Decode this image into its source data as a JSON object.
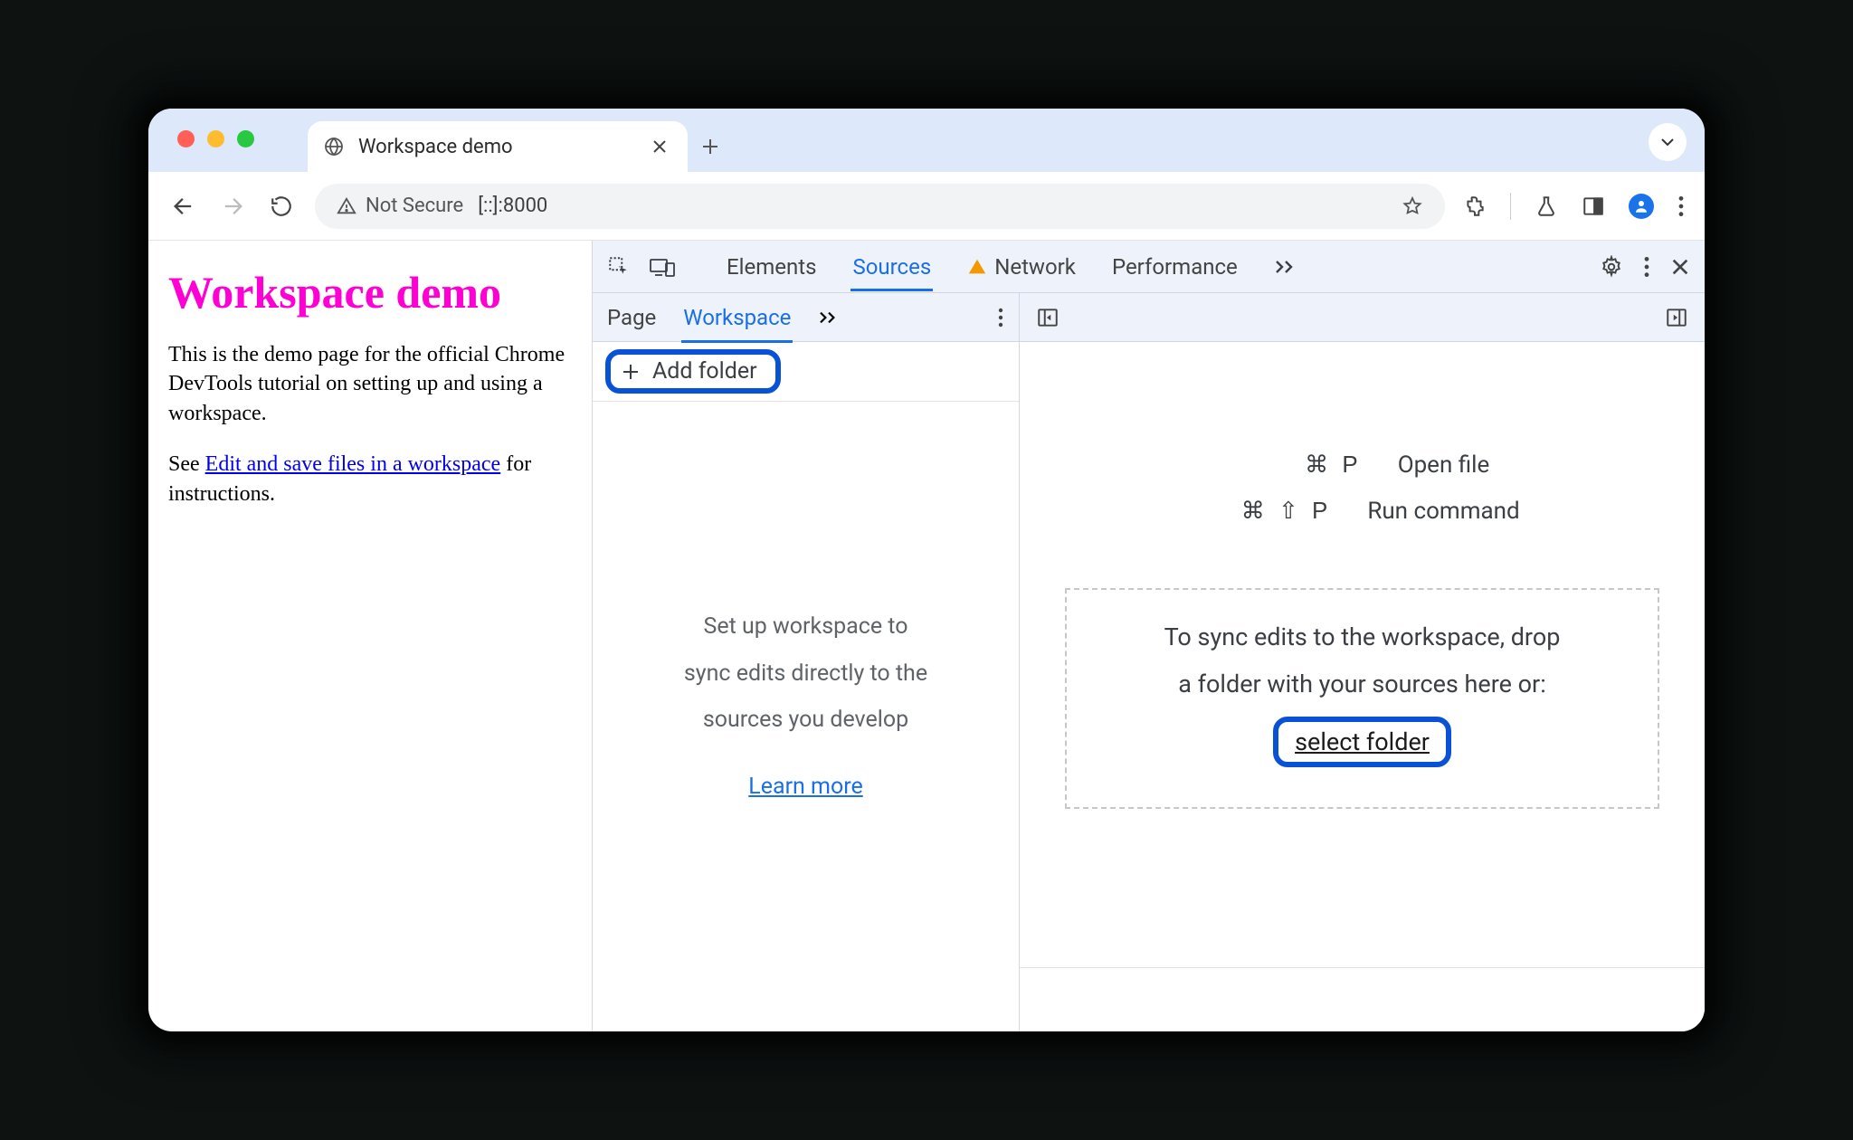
{
  "browser": {
    "tab_title": "Workspace demo",
    "not_secure_label": "Not Secure",
    "url": "[::]:8000"
  },
  "page": {
    "heading": "Workspace demo",
    "p1": "This is the demo page for the official Chrome DevTools tutorial on setting up and using a workspace.",
    "p2_prefix": "See ",
    "p2_link": "Edit and save files in a workspace",
    "p2_suffix": " for instructions."
  },
  "devtools": {
    "tabs": {
      "elements": "Elements",
      "sources": "Sources",
      "network": "Network",
      "performance": "Performance"
    },
    "sub_tabs": {
      "page": "Page",
      "workspace": "Workspace"
    },
    "add_folder": "Add folder",
    "workspace_hint_l1": "Set up workspace to",
    "workspace_hint_l2": "sync edits directly to the",
    "workspace_hint_l3": "sources you develop",
    "learn_more": "Learn more",
    "shortcuts": {
      "open_file_keys": "⌘ P",
      "open_file_label": "Open file",
      "run_cmd_keys": "⌘ ⇧ P",
      "run_cmd_label": "Run command"
    },
    "dropzone_l1": "To sync edits to the workspace, drop",
    "dropzone_l2": "a folder with your sources here or:",
    "select_folder": "select folder"
  }
}
